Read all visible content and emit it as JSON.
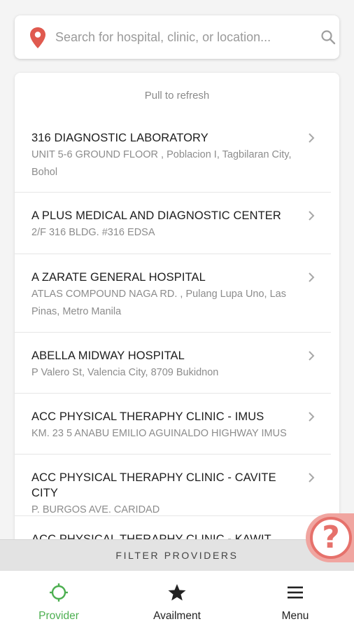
{
  "search": {
    "placeholder": "Search for hospital, clinic, or location...",
    "value": ""
  },
  "list": {
    "refresh_hint": "Pull to refresh",
    "providers": [
      {
        "name": "316 DIAGNOSTIC LABORATORY",
        "address": "UNIT 5-6 GROUND FLOOR , Poblacion I, Tagbilaran City, Bohol"
      },
      {
        "name": "A PLUS MEDICAL AND DIAGNOSTIC CENTER",
        "address": "2/F 316 BLDG. #316 EDSA"
      },
      {
        "name": "A ZARATE GENERAL HOSPITAL",
        "address": "ATLAS COMPOUND NAGA RD. , Pulang Lupa Uno, Las Pinas, Metro Manila"
      },
      {
        "name": "ABELLA MIDWAY HOSPITAL",
        "address": "P Valero St, Valencia City, 8709 Bukidnon"
      },
      {
        "name": "ACC PHYSICAL THERAPHY CLINIC - IMUS",
        "address": "KM. 23 5 ANABU EMILIO AGUINALDO HIGHWAY IMUS"
      },
      {
        "name": "ACC PHYSICAL THERAPHY CLINIC - CAVITE CITY",
        "address": "P. BURGOS AVE. CARIDAD"
      },
      {
        "name": "ACC PHYSICAL THERAPHY CLINIC - KAWIT",
        "address": ""
      }
    ]
  },
  "filter": {
    "label": "FILTER PROVIDERS"
  },
  "help": {
    "symbol": "?"
  },
  "nav": {
    "items": [
      {
        "label": "Provider",
        "icon": "crosshair-icon",
        "active": true
      },
      {
        "label": "Availment",
        "icon": "star-icon",
        "active": false
      },
      {
        "label": "Menu",
        "icon": "hamburger-menu-icon",
        "active": false
      }
    ]
  },
  "colors": {
    "accent_green": "#4caf50",
    "pin_red": "#e05a4f",
    "help_coral": "#e6716b"
  }
}
